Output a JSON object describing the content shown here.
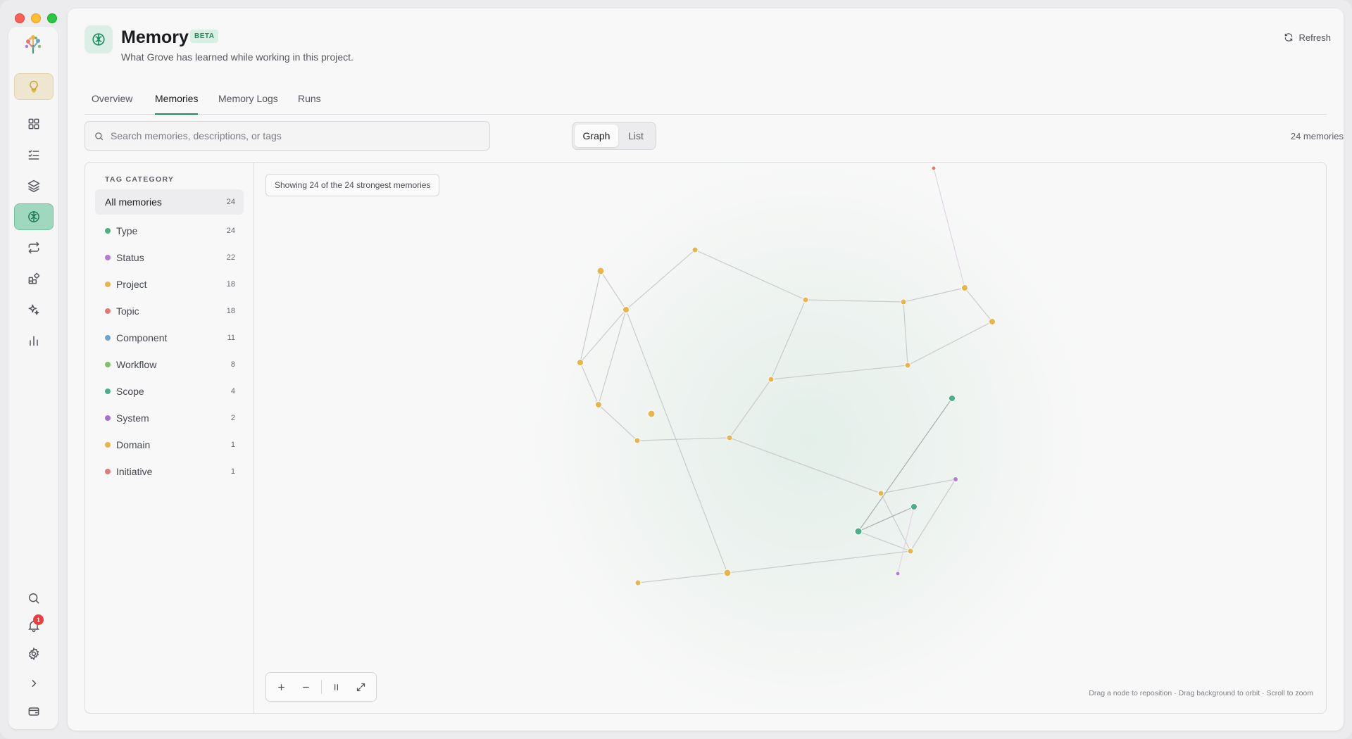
{
  "header": {
    "title": "Memory",
    "badge": "BETA",
    "subtitle": "What Grove has learned while working in this project.",
    "refresh_label": "Refresh"
  },
  "tabs": [
    {
      "label": "Overview",
      "active": false
    },
    {
      "label": "Memories",
      "active": true
    },
    {
      "label": "Memory Logs",
      "active": false
    },
    {
      "label": "Runs",
      "active": false
    }
  ],
  "search": {
    "placeholder": "Search memories, descriptions, or tags",
    "value": ""
  },
  "view_toggle": {
    "graph_label": "Graph",
    "list_label": "List",
    "selected": "Graph"
  },
  "memory_count_label": "24 memories",
  "sidebar": {
    "title": "TAG CATEGORY",
    "all": {
      "label": "All memories",
      "count": "24"
    },
    "categories": [
      {
        "label": "Type",
        "count": "24",
        "color": "#4caf7d"
      },
      {
        "label": "Status",
        "count": "22",
        "color": "#b57ad6"
      },
      {
        "label": "Project",
        "count": "18",
        "color": "#e7b54a"
      },
      {
        "label": "Topic",
        "count": "18",
        "color": "#e07a78"
      },
      {
        "label": "Component",
        "count": "11",
        "color": "#6fa3cc"
      },
      {
        "label": "Workflow",
        "count": "8",
        "color": "#7fc06a"
      },
      {
        "label": "Scope",
        "count": "4",
        "color": "#46b08b"
      },
      {
        "label": "System",
        "count": "2",
        "color": "#a66fd6"
      },
      {
        "label": "Domain",
        "count": "1",
        "color": "#e7b54a"
      },
      {
        "label": "Initiative",
        "count": "1",
        "color": "#e07a78"
      }
    ]
  },
  "graph": {
    "showing_label": "Showing 24 of the 24 strongest memories",
    "hint": "Drag a node to reposition · Drag background to orbit · Scroll to zoom",
    "node_colors": {
      "project": "#e7b54a",
      "scope": "#46b08b",
      "system": "#b57ad6",
      "topic": "#e07a78"
    }
  },
  "rail": {
    "items": [
      "lightbulb-icon",
      "grid-icon",
      "checklist-icon",
      "layers-icon",
      "brain-icon",
      "repeat-icon",
      "apps-icon",
      "sparkles-icon",
      "chart-icon"
    ],
    "bottom": [
      "search-icon",
      "bell-icon",
      "gear-icon",
      "chevron-right-icon",
      "screen-icon"
    ],
    "notification_count": "1"
  }
}
